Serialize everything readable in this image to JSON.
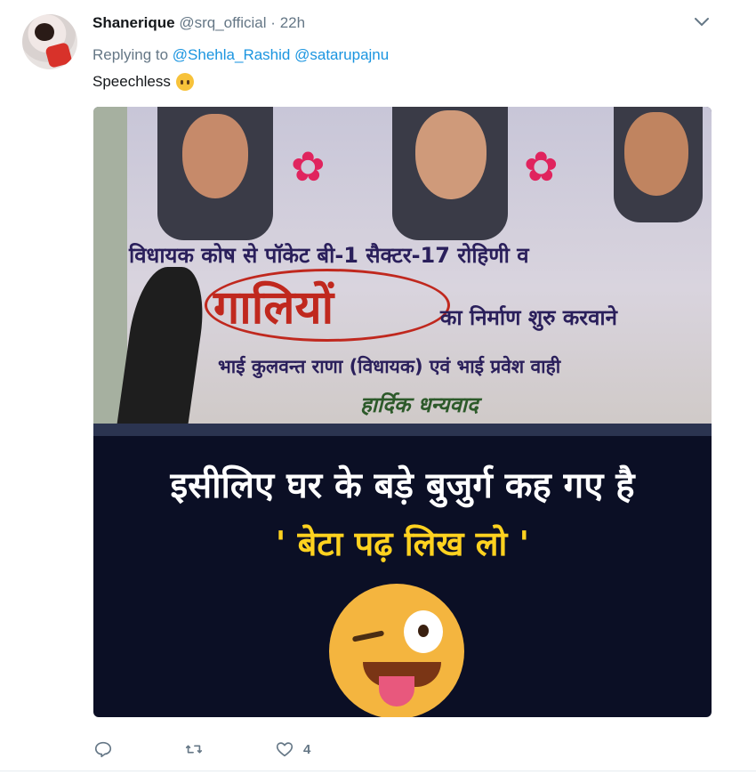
{
  "tweet": {
    "name": "Shanerique",
    "handle": "@srq_official",
    "separator": "·",
    "time": "22h",
    "reply_prefix": "Replying to",
    "reply_user_1": "@Shehla_Rashid",
    "reply_user_2": "@satarupajnu",
    "text": "Speechless"
  },
  "image": {
    "banner_line_1": "विधायक कोष से पॉकेट बी-1 सैक्टर-17 रोहिणी व",
    "banner_line_2": "गालियों",
    "banner_line_3": "का निर्माण शुरु करवाने",
    "banner_line_4": "भाई कुलवन्त राणा (विधायक) एवं भाई प्रवेश वाही",
    "banner_line_5": "हार्दिक धन्यवाद",
    "caption_line_1": "इसीलिए घर के बड़े बुजुर्ग कह गए है",
    "caption_line_2": "' बेटा पढ़ लिख लो '"
  },
  "actions": {
    "reply_icon": "reply-icon",
    "retweet_icon": "retweet-icon",
    "like_icon": "heart-icon",
    "like_count": "4"
  },
  "colors": {
    "link": "#1b95e0",
    "muted": "#657786",
    "caption_yellow": "#ffd21f"
  }
}
